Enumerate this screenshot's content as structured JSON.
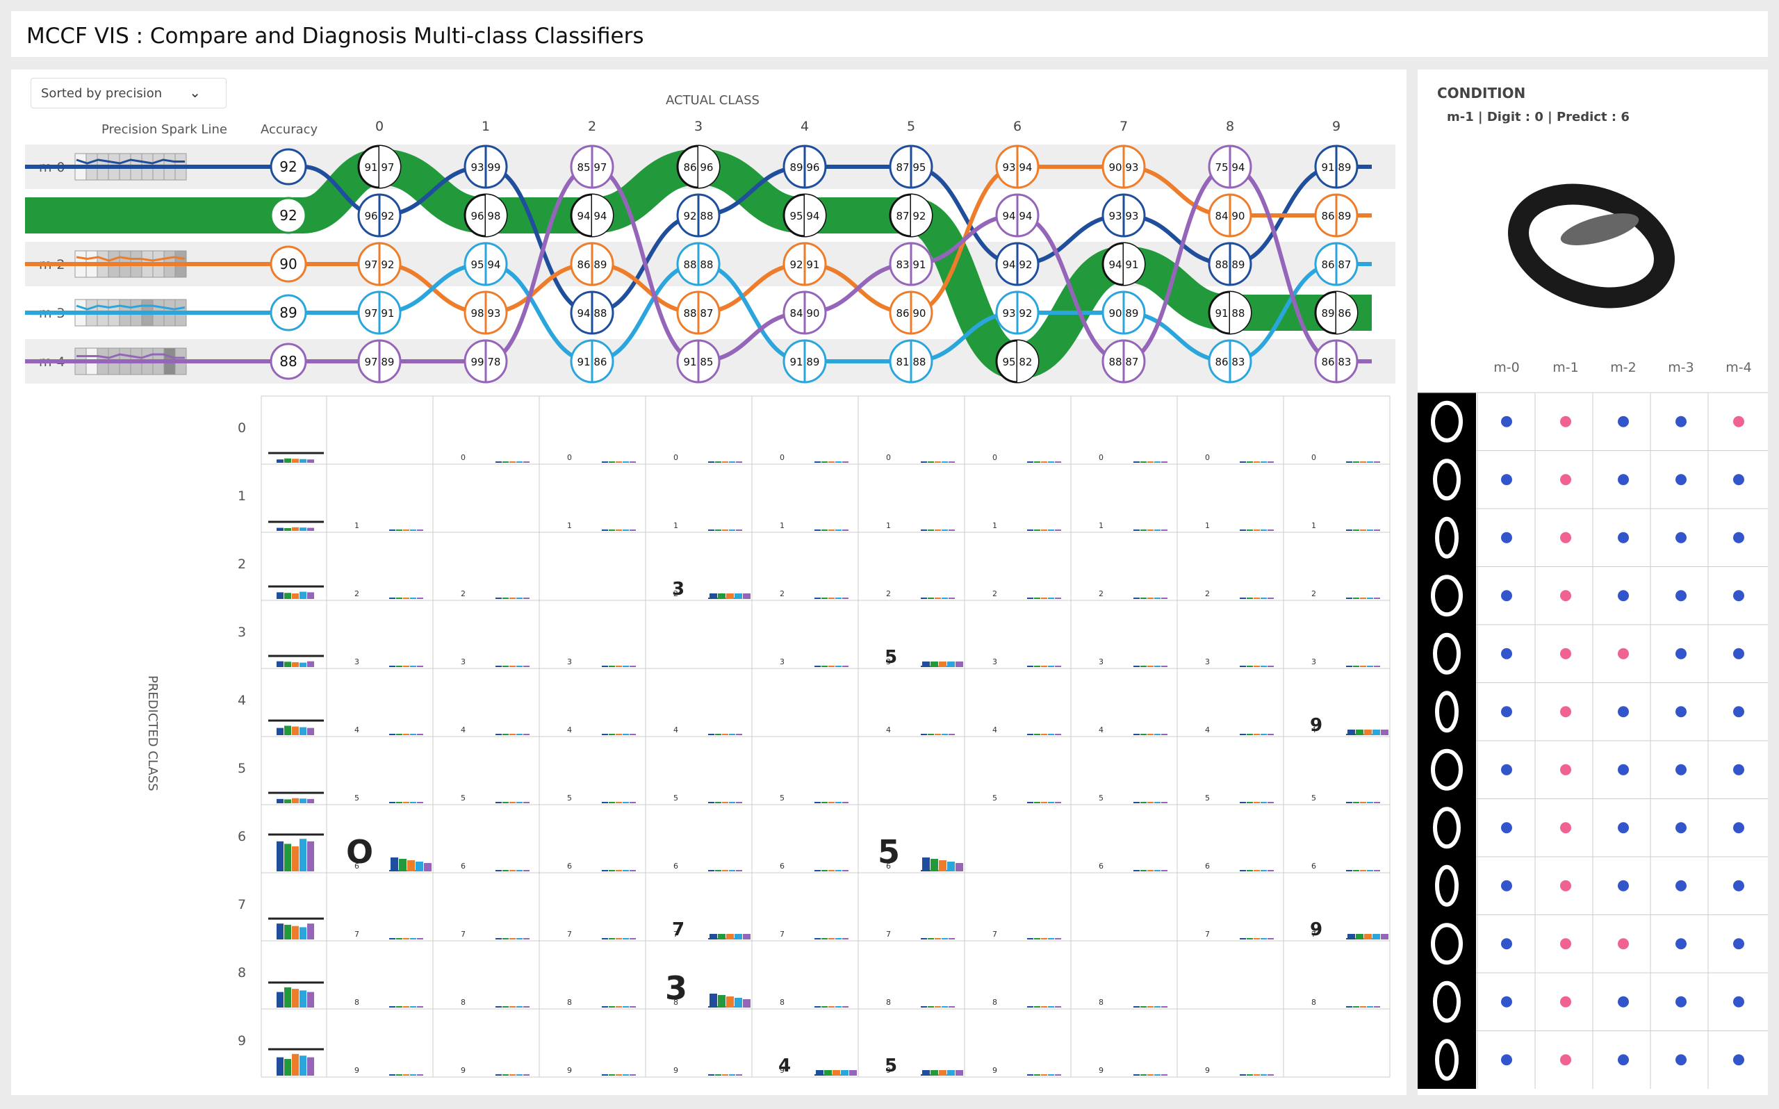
{
  "app": {
    "title": "MCCF VIS : Compare and Diagnosis Multi-class Classifiers"
  },
  "controls": {
    "sort_label": "Sorted by precision"
  },
  "headers": {
    "spark": "Precision Spark Line",
    "accuracy": "Accuracy",
    "actual_class": "ACTUAL CLASS",
    "predicted_class": "PREDICTED CLASS"
  },
  "colors": {
    "m-0": "#1f4e9c",
    "m-1": "#229a3b",
    "m-2": "#ee7d2b",
    "m-3": "#2aa6dc",
    "m-4": "#9465b8",
    "correct_dot": "#3355cc",
    "wrong_dot": "#f06292"
  },
  "models": [
    {
      "name": "m-0",
      "accuracy": "92",
      "spark_shades": [
        0,
        1,
        1,
        1,
        1,
        1,
        1,
        1,
        1,
        1
      ]
    },
    {
      "name": "m-1",
      "accuracy": "92",
      "spark_shades": [
        0,
        1,
        2,
        1,
        2,
        1,
        1,
        2,
        1,
        1
      ]
    },
    {
      "name": "m-2",
      "accuracy": "90",
      "spark_shades": [
        0,
        0,
        1,
        2,
        2,
        2,
        1,
        1,
        2,
        3
      ]
    },
    {
      "name": "m-3",
      "accuracy": "89",
      "spark_shades": [
        0,
        1,
        1,
        1,
        2,
        2,
        3,
        2,
        2,
        2
      ]
    },
    {
      "name": "m-4",
      "accuracy": "88",
      "spark_shades": [
        1,
        0,
        2,
        2,
        2,
        2,
        2,
        2,
        4,
        2
      ]
    }
  ],
  "classes": [
    "0",
    "1",
    "2",
    "3",
    "4",
    "5",
    "6",
    "7",
    "8",
    "9"
  ],
  "rank_order": [
    [
      "m-1",
      "m-0",
      "m-2",
      "m-3",
      "m-4"
    ],
    [
      "m-0",
      "m-1",
      "m-3",
      "m-2",
      "m-4"
    ],
    [
      "m-4",
      "m-1",
      "m-2",
      "m-0",
      "m-3"
    ],
    [
      "m-1",
      "m-0",
      "m-3",
      "m-2",
      "m-4"
    ],
    [
      "m-0",
      "m-1",
      "m-2",
      "m-4",
      "m-3"
    ],
    [
      "m-0",
      "m-1",
      "m-4",
      "m-2",
      "m-3"
    ],
    [
      "m-2",
      "m-4",
      "m-0",
      "m-3",
      "m-1"
    ],
    [
      "m-2",
      "m-0",
      "m-1",
      "m-3",
      "m-4"
    ],
    [
      "m-4",
      "m-2",
      "m-0",
      "m-1",
      "m-3"
    ],
    [
      "m-0",
      "m-2",
      "m-3",
      "m-1",
      "m-4"
    ]
  ],
  "node_labels": [
    [
      "91 97",
      "96 92",
      "97 92",
      "97 91",
      "97 89"
    ],
    [
      "93 99",
      "96 98",
      "95 94",
      "98 93",
      "99 78"
    ],
    [
      "85 97",
      "94 94",
      "86 89",
      "94 88",
      "91 86"
    ],
    [
      "86 96",
      "92 88",
      "88 88",
      "88 87",
      "91 85"
    ],
    [
      "89 96",
      "95 94",
      "92 91",
      "84 90",
      "91 89"
    ],
    [
      "87 95",
      "87 92",
      "83 91",
      "86 90",
      "81 88"
    ],
    [
      "93 94",
      "94 94",
      "94 92",
      "93 92",
      "95 82"
    ],
    [
      "90 93",
      "93 93",
      "94 91",
      "90 89",
      "88 87"
    ],
    [
      "75 94",
      "84 90",
      "88 89",
      "91 88",
      "86 83"
    ],
    [
      "91 89",
      "86 89",
      "86 87",
      "89 86",
      "86 83"
    ]
  ],
  "matrix": {
    "row_labels": [
      "0",
      "1",
      "2",
      "3",
      "4",
      "5",
      "6",
      "7",
      "8",
      "9"
    ],
    "digit_cells": [
      {
        "row": 6,
        "col": 0,
        "glyph": "O",
        "size": "big"
      },
      {
        "row": 6,
        "col": 5,
        "glyph": "5",
        "size": "big"
      },
      {
        "row": 2,
        "col": 3,
        "glyph": "3",
        "size": "mid"
      },
      {
        "row": 8,
        "col": 3,
        "glyph": "3",
        "size": "big"
      },
      {
        "row": 7,
        "col": 3,
        "glyph": "7",
        "size": "mid"
      },
      {
        "row": 7,
        "col": 9,
        "glyph": "9",
        "size": "mid"
      },
      {
        "row": 3,
        "col": 5,
        "glyph": "5",
        "size": "mid"
      },
      {
        "row": 9,
        "col": 4,
        "glyph": "4",
        "size": "mid"
      },
      {
        "row": 9,
        "col": 5,
        "glyph": "5",
        "size": "mid"
      },
      {
        "row": 4,
        "col": 9,
        "glyph": "9",
        "size": "mid"
      }
    ]
  },
  "condition": {
    "title": "CONDITION",
    "subtitle": "m-1 | Digit : 0 | Predict : 6",
    "columns": [
      "m-0",
      "m-1",
      "m-2",
      "m-3",
      "m-4"
    ],
    "rows": [
      {
        "digit": "0",
        "correct": [
          true,
          false,
          true,
          true,
          false
        ]
      },
      {
        "digit": "0",
        "correct": [
          true,
          false,
          true,
          true,
          true
        ]
      },
      {
        "digit": "0",
        "correct": [
          true,
          false,
          true,
          true,
          true
        ]
      },
      {
        "digit": "0",
        "correct": [
          true,
          false,
          true,
          true,
          true
        ]
      },
      {
        "digit": "0",
        "correct": [
          true,
          false,
          false,
          true,
          true
        ]
      },
      {
        "digit": "0",
        "correct": [
          true,
          false,
          true,
          true,
          true
        ]
      },
      {
        "digit": "0",
        "correct": [
          true,
          false,
          true,
          true,
          true
        ]
      },
      {
        "digit": "0",
        "correct": [
          true,
          false,
          true,
          true,
          true
        ]
      },
      {
        "digit": "0",
        "correct": [
          true,
          false,
          true,
          true,
          true
        ]
      },
      {
        "digit": "0",
        "correct": [
          true,
          false,
          false,
          true,
          true
        ]
      },
      {
        "digit": "0",
        "correct": [
          true,
          false,
          true,
          true,
          true
        ]
      },
      {
        "digit": "0",
        "correct": [
          true,
          false,
          true,
          true,
          true
        ]
      }
    ]
  }
}
